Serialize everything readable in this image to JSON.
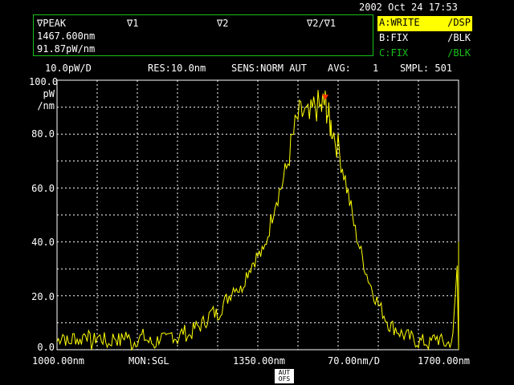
{
  "header": {
    "datetime": "2002 Oct 24 17:53"
  },
  "marker_panel": {
    "peak_label": "∇PEAK",
    "v1_label": "∇1",
    "v2_label": "∇2",
    "ratio_label": "∇2/∇1",
    "peak_wavelength": "1467.600nm",
    "peak_level": "91.87pW/nm"
  },
  "traces": [
    {
      "name": "A:WRITE",
      "mode": "/DSP"
    },
    {
      "name": "B:FIX",
      "mode": "/BLK"
    },
    {
      "name": "C:FIX",
      "mode": "/BLK"
    }
  ],
  "status_bar": {
    "scale": "10.0pW/D",
    "resolution": "RES:10.0nm",
    "sensitivity": "SENS:NORM AUT",
    "avg_label": "AVG:",
    "avg_value": "1",
    "sampling": "SMPL: 501"
  },
  "y_axis": {
    "unit_line1": "pW",
    "unit_line2": "/nm",
    "ticks": [
      "100.0",
      "80.0",
      "60.0",
      "40.0",
      "20.0",
      "0.0"
    ]
  },
  "x_axis": {
    "start": "1000.00nm",
    "monitor": "MON:SGL",
    "center": "1350.00nm",
    "span_per_div": "70.00nm/D",
    "stop": "1700.00nm"
  },
  "softkey": {
    "line1": "AUT",
    "line2": "OFS"
  },
  "colors": {
    "trace": "#ffff00",
    "grid": "#ffffff",
    "frame_green": "#18c018",
    "peak_marker": "#ff3300"
  },
  "chart_data": {
    "type": "line",
    "xlabel": "",
    "ylabel": "pW/nm",
    "xlim": [
      1000,
      1700
    ],
    "ylim": [
      0,
      100
    ],
    "grid": true,
    "peak": {
      "x": 1467.6,
      "y": 91.87
    },
    "series": [
      {
        "x": [
          1000,
          1010,
          1020,
          1030,
          1040,
          1050,
          1060,
          1070,
          1080,
          1090,
          1100,
          1110,
          1120,
          1130,
          1140,
          1150,
          1160,
          1170,
          1180,
          1190,
          1200,
          1210,
          1220,
          1230,
          1240,
          1250,
          1260,
          1270,
          1280,
          1290,
          1300,
          1310,
          1320,
          1330,
          1340,
          1350,
          1360,
          1370,
          1380,
          1390,
          1400,
          1410,
          1420,
          1430,
          1440,
          1450,
          1460,
          1465,
          1470,
          1475,
          1480,
          1490,
          1500,
          1510,
          1520,
          1530,
          1540,
          1550,
          1560,
          1570,
          1580,
          1590,
          1600,
          1610,
          1620,
          1630,
          1640,
          1650,
          1660,
          1670,
          1680,
          1690,
          1700
        ],
        "y": [
          3,
          6,
          2,
          5,
          3,
          7,
          2,
          5,
          4,
          2,
          5,
          3,
          6,
          2,
          4,
          5,
          3,
          2,
          5,
          3,
          6,
          4,
          7,
          5,
          8,
          9,
          11,
          14,
          13,
          17,
          20,
          24,
          22,
          28,
          32,
          35,
          36,
          45,
          55,
          60,
          67,
          78,
          86,
          88,
          85,
          91,
          89,
          91.9,
          90,
          84,
          82,
          75,
          66,
          55,
          44,
          36,
          28,
          22,
          17,
          13,
          9,
          8,
          6,
          5,
          4,
          3,
          3,
          2,
          5,
          3,
          2,
          4,
          40
        ]
      }
    ]
  }
}
